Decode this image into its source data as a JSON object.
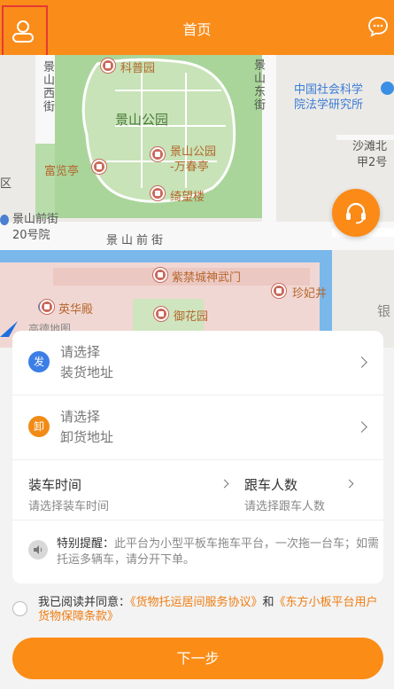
{
  "header": {
    "title": "首页",
    "bg_color": "#fa8c1a",
    "left_icon": "user-icon",
    "right_icon": "chat-bubble-icon"
  },
  "map": {
    "labels": {
      "jingshan_park": "景山公园",
      "kepu_garden": "科普园",
      "fulan_pavilion": "富览亭",
      "wanchun_pavilion_1": "景山公园",
      "wanchun_pavilion_2": "-万春亭",
      "qiwang_tower": "绮望楼",
      "jingshan_front_street": "景山前街",
      "jingshan_west_street": "景山西街",
      "jingshan_east_street": "景山东街",
      "cass_law_1": "中国社会科学",
      "cass_law_2": "院法学研究所",
      "shatan_north_1": "沙滩北",
      "shatan_north_2": "甲2号",
      "jingshan_front_20_1": "景山前街",
      "jingshan_front_20_2": "20号院",
      "district": "区",
      "shenwu_gate": "紫禁城神武门",
      "zhenfei_well": "珍妃井",
      "yinghua_hall": "英华殿",
      "imperial_garden": "御花园",
      "silver": "银",
      "amap_watermark": "高德地图"
    }
  },
  "support_button": {
    "icon": "headset-icon",
    "color": "#fb8a17"
  },
  "form": {
    "load": {
      "badge": "发",
      "line1": "请选择",
      "line2": "装货地址",
      "badge_color": "#3b7ee6"
    },
    "unload": {
      "badge": "卸",
      "line1": "请选择",
      "line2": "卸货地址",
      "badge_color": "#f18b16"
    },
    "load_time": {
      "label": "装车时间",
      "placeholder": "请选择装车时间"
    },
    "passengers": {
      "label": "跟车人数",
      "placeholder": "请选择跟车人数"
    },
    "notice": {
      "title": "特别提醒：",
      "text": "此平台为小型平板车拖车平台，一次拖一台车；如需托运多辆车，请分开下单。"
    }
  },
  "agreement": {
    "prefix": "我已阅读并同意：",
    "link1": "《货物托运居间服务协议》",
    "and": "和",
    "link2": "《东方小板平台用户货物保障条款》"
  },
  "next_button": {
    "label": "下一步",
    "color": "#fb8c16"
  }
}
